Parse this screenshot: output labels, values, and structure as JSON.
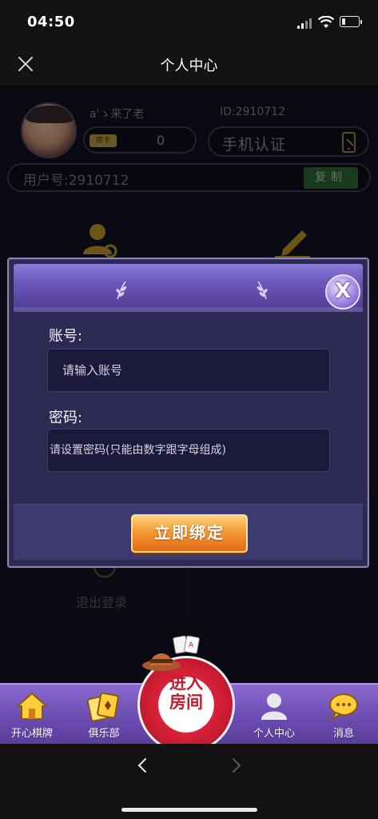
{
  "status_bar": {
    "time": "04:50",
    "icons": [
      "signal-icon",
      "wifi-icon",
      "battery-icon"
    ]
  },
  "nav": {
    "title": "个人中心",
    "close_icon": "close-icon"
  },
  "profile": {
    "nickname": "a'ゝ来了老",
    "coin_tag": "房卡",
    "coin_value": "0",
    "id_label": "ID:2910712",
    "phone_auth_label": "手机认证",
    "uid_label": "用户号:2910712",
    "copy_label": "复制"
  },
  "menu": {
    "logout_label": "退出登录"
  },
  "dialog": {
    "account_label": "账号:",
    "account_placeholder": "请输入账号",
    "password_label": "密码:",
    "password_placeholder": "请设置密码(只能由数字跟字母组成)",
    "bind_button_label": "立即绑定",
    "close_glyph": "X"
  },
  "tab_bar": {
    "items": [
      {
        "label": "开心棋牌",
        "icon": "home-icon"
      },
      {
        "label": "俱乐部",
        "icon": "cards-icon"
      },
      {
        "label": "个人中心",
        "icon": "person-icon"
      },
      {
        "label": "消息",
        "icon": "chat-icon"
      }
    ],
    "enter_room_label": "进入房间"
  },
  "colors": {
    "accent_orange": "#f39a35",
    "dialog_bg": "#2c2a52",
    "tab_purple": "#6e4fb4",
    "chip_red": "#c11a2e"
  }
}
